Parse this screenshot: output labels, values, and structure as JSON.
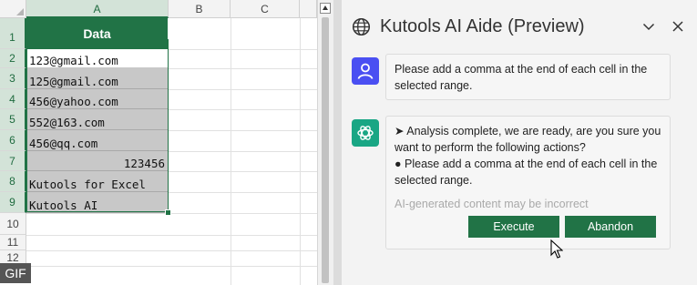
{
  "sheet": {
    "columns": [
      "A",
      "B",
      "C"
    ],
    "rows": [
      "1",
      "2",
      "3",
      "4",
      "5",
      "6",
      "7",
      "8",
      "9",
      "10",
      "11",
      "12"
    ],
    "header": "Data",
    "cells": [
      "123@gmail.com",
      "125@gmail.com",
      "456@yahoo.com",
      "552@163.com",
      "456@qq.com",
      "123456",
      "Kutools for Excel",
      "Kutools AI"
    ]
  },
  "badge": "GIF",
  "panel": {
    "title": "Kutools AI Aide (Preview)",
    "user_message": "Please add a comma at the end of each cell in the selected range.",
    "ai_line1": "➤ Analysis complete, we are ready, are you sure you want to perform the following actions?",
    "ai_line2": "● Please add a comma at the end of each cell in the selected range.",
    "disclaimer": "AI-generated content may be incorrect",
    "execute_label": "Execute",
    "abandon_label": "Abandon"
  },
  "colors": {
    "excel_green": "#217346",
    "user_avatar": "#4a4ff2",
    "ai_avatar": "#19a684"
  },
  "icons": [
    "globe-icon",
    "chevron-down-icon",
    "close-icon",
    "user-icon",
    "openai-icon",
    "mouse-cursor-icon"
  ]
}
